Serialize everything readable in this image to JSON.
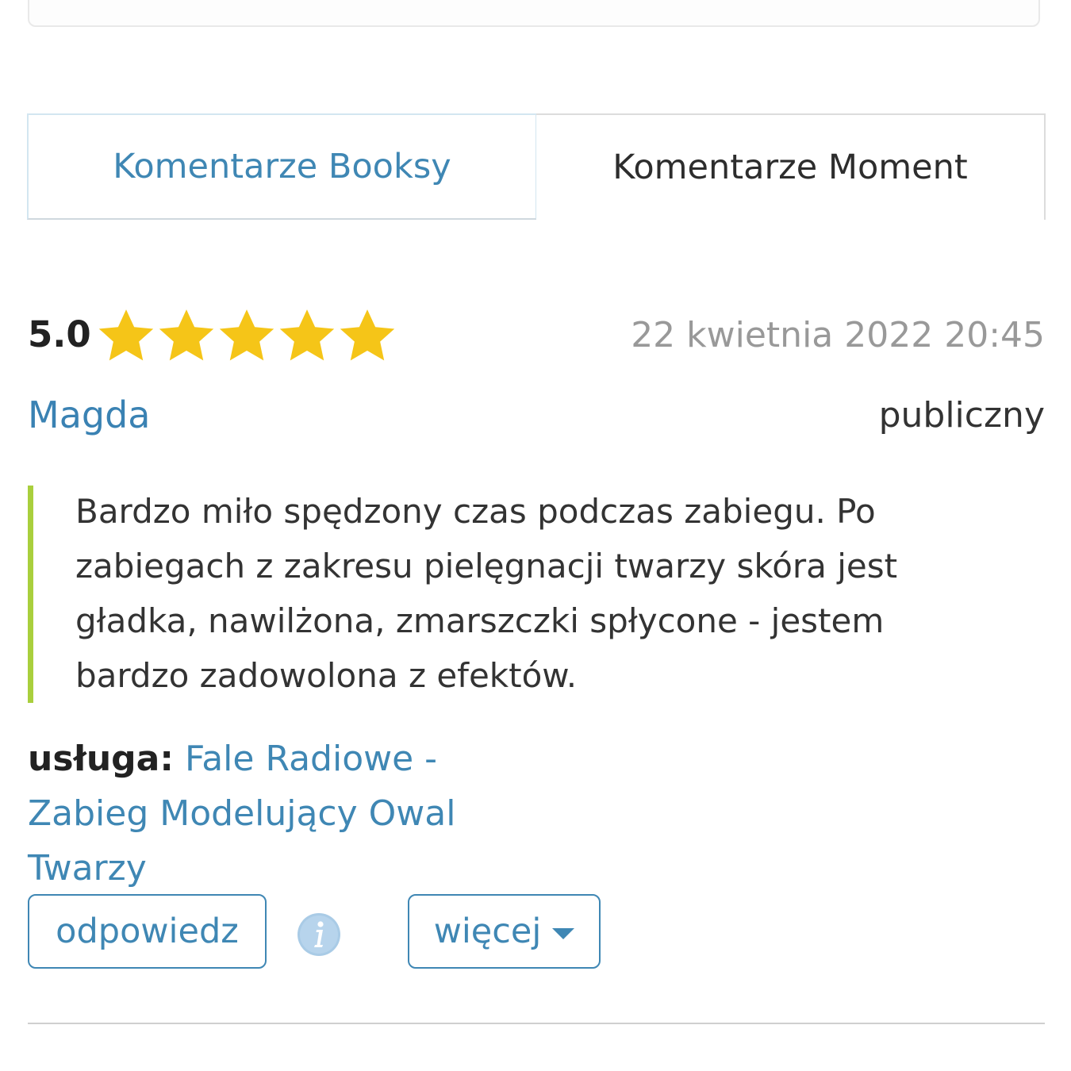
{
  "tabs": {
    "booksy": "Komentarze Booksy",
    "moment": "Komentarze Moment"
  },
  "review": {
    "score": "5.0",
    "stars": 5,
    "star_color": "#f5c518",
    "date": "22 kwietnia 2022 20:45",
    "author": "Magda",
    "visibility": "publiczny",
    "text": "Bardzo miło spędzony czas podczas zabiegu. Po zabiegach z zakresu pielęgnacji twarzy skóra jest gładka, nawilżona, zmarszczki spłycone - jestem bardzo zadowolona z efektów.",
    "service_label": "usługa:",
    "service_name": "Fale Radiowe - Zabieg Modelujący Owal Twarzy"
  },
  "actions": {
    "reply": "odpowiedz",
    "more": "więcej",
    "info_icon": "info-icon"
  },
  "colors": {
    "accent": "#3f87b4",
    "quote_bar": "#a9cf3d"
  }
}
